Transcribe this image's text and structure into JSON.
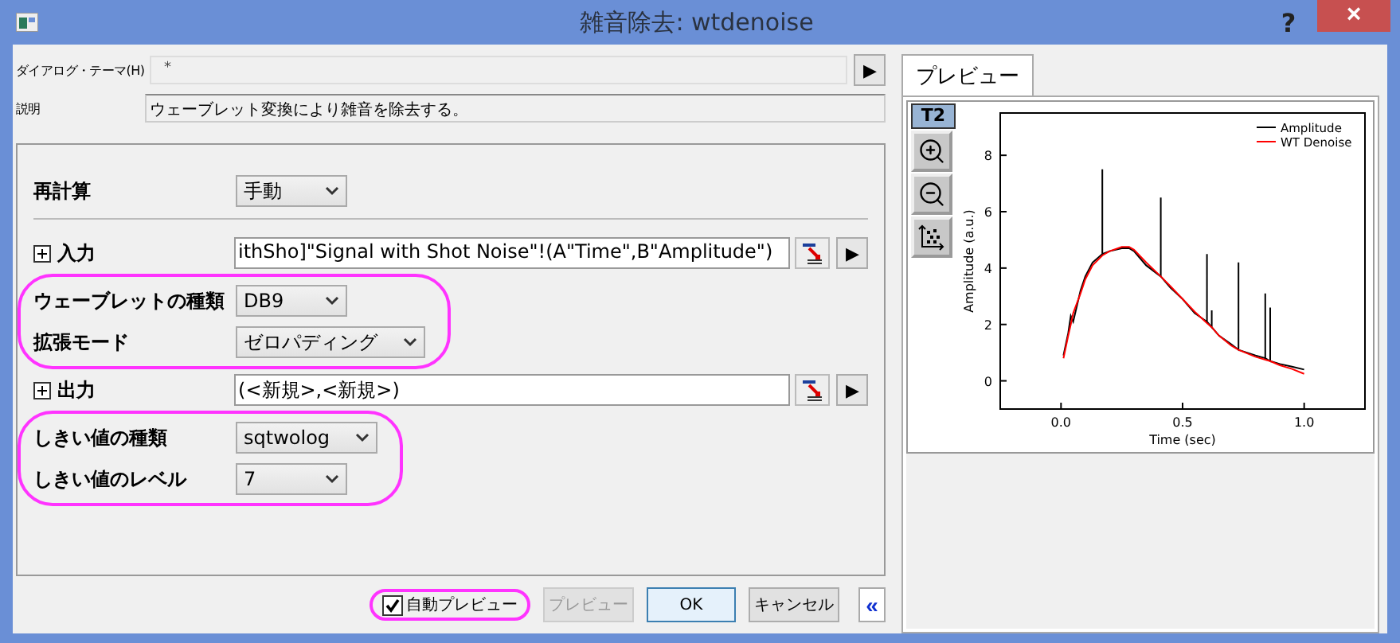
{
  "window": {
    "title": "雑音除去: wtdenoise",
    "help": "?",
    "close": "×"
  },
  "theme": {
    "label": "ダイアログ・テーマ(H)",
    "value": "*",
    "button": "▶"
  },
  "description": {
    "label": "説明",
    "text": "ウェーブレット変換により雑音を除去する。"
  },
  "sections": [
    {
      "highlighted": false,
      "rows": [
        {
          "kind": "dropdown",
          "label": "再計算",
          "value": "手動"
        },
        {
          "kind": "divider"
        },
        {
          "kind": "range",
          "label": "入力",
          "value": "ithSho]\"Signal with Shot Noise\"!(A\"Time\",B\"Amplitude\")",
          "expanded": false,
          "button": "▶"
        }
      ]
    },
    {
      "highlighted": true,
      "rows": [
        {
          "kind": "dropdown",
          "label": "ウェーブレットの種類",
          "value": "DB9"
        },
        {
          "kind": "dropdown",
          "label": "拡張モード",
          "value": "ゼロパディング"
        }
      ]
    },
    {
      "highlighted": false,
      "rows": [
        {
          "kind": "range",
          "label": "出力",
          "value": "(<新規>,<新規>)",
          "expanded": false,
          "button": "▶"
        }
      ]
    },
    {
      "highlighted": true,
      "rows": [
        {
          "kind": "dropdown",
          "label": "しきい値の種類",
          "value": "sqtwolog"
        },
        {
          "kind": "dropdown",
          "label": "しきい値のレベル",
          "value": "7"
        }
      ]
    }
  ],
  "footer": {
    "auto_preview": {
      "label": "自動プレビュー",
      "checked": true,
      "highlighted": true
    },
    "buttons": [
      {
        "label": "プレビュー",
        "disabled": true,
        "default": false
      },
      {
        "label": "OK",
        "disabled": false,
        "default": true
      },
      {
        "label": "キャンセル",
        "disabled": false,
        "default": false
      }
    ],
    "collapse": "«"
  },
  "preview": {
    "tab": {
      "label": "プレビュー",
      "selected": true
    },
    "toolbar": {
      "label": "T2"
    },
    "chart_data": {
      "type": "line",
      "legend": true,
      "xlabel": "Time (sec)",
      "ylabel": "Amplitude (a.u.)",
      "xlim": [
        -0.25,
        1.25
      ],
      "ylim": [
        -1,
        9.5
      ],
      "xticks": [
        {
          "value": 0,
          "label": "0.0"
        },
        {
          "value": 0.5,
          "label": "0.5"
        },
        {
          "value": 1,
          "label": "1.0"
        }
      ],
      "yticks": [
        0,
        2,
        4,
        6,
        8
      ],
      "x": [
        0.01,
        0.03,
        0.04,
        0.05,
        0.08,
        0.1,
        0.13,
        0.17,
        0.17,
        0.17,
        0.2,
        0.25,
        0.28,
        0.3,
        0.35,
        0.41,
        0.41,
        0.41,
        0.45,
        0.5,
        0.55,
        0.6,
        0.6,
        0.6,
        0.62,
        0.62,
        0.62,
        0.65,
        0.7,
        0.73,
        0.73,
        0.73,
        0.8,
        0.84,
        0.84,
        0.84,
        0.86,
        0.86,
        0.86,
        0.9,
        0.95,
        1.0
      ],
      "series": [
        {
          "name": "Amplitude",
          "color": "#000000",
          "values": [
            0.9,
            1.7,
            2.3,
            2.1,
            3.2,
            3.7,
            4.2,
            4.5,
            7.5,
            4.5,
            4.6,
            4.7,
            4.7,
            4.6,
            4.1,
            3.7,
            6.5,
            3.7,
            3.3,
            2.9,
            2.4,
            2.1,
            4.5,
            2.1,
            1.9,
            2.5,
            1.9,
            1.6,
            1.3,
            1.1,
            4.2,
            1.1,
            0.9,
            0.8,
            3.1,
            0.8,
            0.7,
            2.6,
            0.7,
            0.6,
            0.5,
            0.4
          ]
        },
        {
          "name": "WT Denoise",
          "color": "#ff0000",
          "values": [
            0.8,
            1.6,
            2.0,
            2.4,
            3.1,
            3.6,
            4.1,
            4.45,
            4.45,
            4.45,
            4.6,
            4.75,
            4.75,
            4.65,
            4.2,
            3.7,
            3.7,
            3.7,
            3.35,
            2.9,
            2.45,
            2.05,
            2.05,
            2.05,
            1.9,
            1.9,
            1.9,
            1.6,
            1.25,
            1.1,
            1.1,
            1.1,
            0.85,
            0.75,
            0.75,
            0.75,
            0.7,
            0.7,
            0.7,
            0.55,
            0.42,
            0.25
          ]
        }
      ]
    }
  }
}
